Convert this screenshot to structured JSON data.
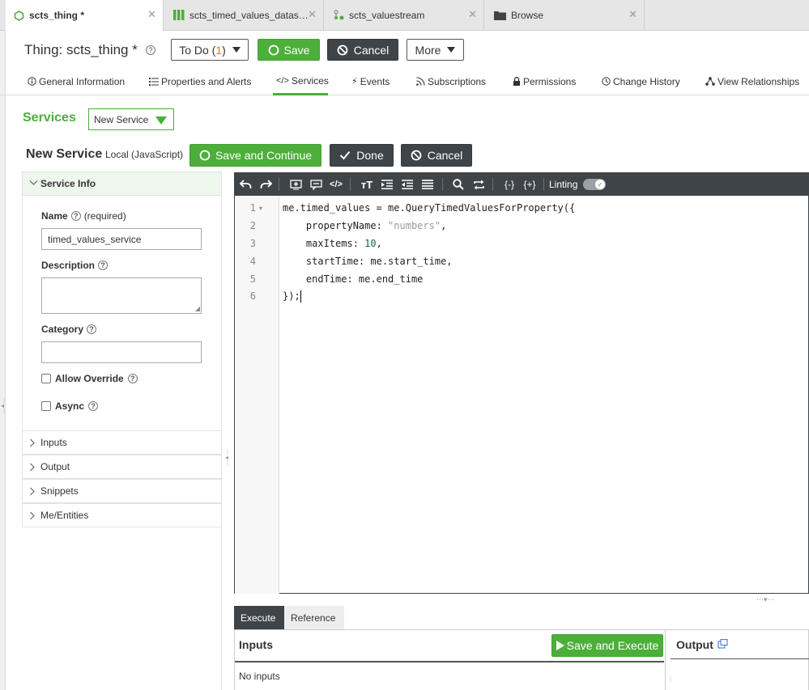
{
  "tabs": [
    {
      "label": "scts_thing *",
      "icon": "thing-icon",
      "active": true
    },
    {
      "label": "scts_timed_values_datas…",
      "icon": "datashape-icon",
      "active": false
    },
    {
      "label": "scts_valuestream",
      "icon": "valuestream-icon",
      "active": false
    },
    {
      "label": "Browse",
      "icon": "folder-icon",
      "active": false
    }
  ],
  "header": {
    "title": "Thing: scts_thing *",
    "todo_label": "To Do (",
    "todo_count": "1",
    "todo_close": ")",
    "save": "Save",
    "cancel": "Cancel",
    "more": "More"
  },
  "subnav": [
    {
      "label": "General Information",
      "icon": "info-icon"
    },
    {
      "label": "Properties and Alerts",
      "icon": "list-icon"
    },
    {
      "label": "Services",
      "icon": "code-icon",
      "active": true
    },
    {
      "label": "Events",
      "icon": "bolt-icon"
    },
    {
      "label": "Subscriptions",
      "icon": "rss-icon"
    },
    {
      "label": "Permissions",
      "icon": "lock-icon"
    },
    {
      "label": "Change History",
      "icon": "clock-icon"
    },
    {
      "label": "View Relationships",
      "icon": "relationships-icon"
    }
  ],
  "services": {
    "label": "Services",
    "dropdown": "New Service"
  },
  "service_editor": {
    "heading": "New Service",
    "type": "Local (JavaScript)",
    "save_continue": "Save and Continue",
    "done": "Done",
    "cancel": "Cancel"
  },
  "service_info": {
    "header": "Service Info",
    "name_label": "Name",
    "name_required": "(required)",
    "name_value": "timed_values_service",
    "description_label": "Description",
    "description_value": "",
    "category_label": "Category",
    "category_value": "",
    "allow_override": "Allow Override",
    "async": "Async"
  },
  "accordion": [
    "Inputs",
    "Output",
    "Snippets",
    "Me/Entities"
  ],
  "toolbar": {
    "linting_label": "Linting"
  },
  "code": {
    "line_numbers": [
      "1",
      "2",
      "3",
      "4",
      "5",
      "6"
    ],
    "l1": "me.timed_values = me.QueryTimedValuesForProperty({",
    "l2_key": "    propertyName: ",
    "l2_str": "\"numbers\"",
    "l2_end": ",",
    "l3_key": "    maxItems: ",
    "l3_num": "10",
    "l3_end": ",",
    "l4": "    startTime: me.start_time,",
    "l5": "    endTime: me.end_time",
    "l6": "});"
  },
  "bottom": {
    "tab_execute": "Execute",
    "tab_reference": "Reference",
    "inputs_title": "Inputs",
    "save_execute": "Save and Execute",
    "no_inputs": "No inputs",
    "output_title": "Output"
  },
  "colors": {
    "accent_green": "#4caf3a",
    "dark": "#3f4448",
    "todo_orange": "#e07b00"
  }
}
